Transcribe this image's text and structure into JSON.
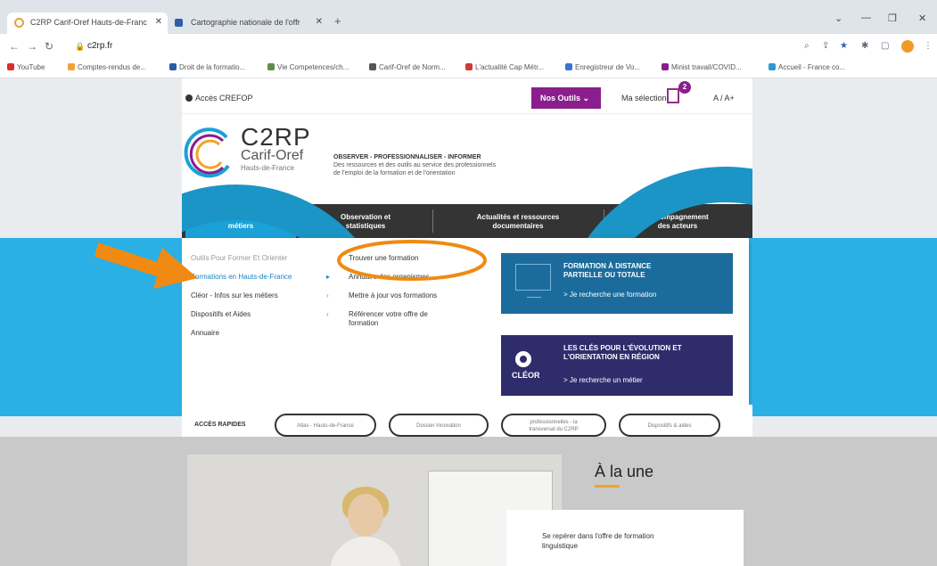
{
  "browser": {
    "tabs": [
      {
        "title": "C2RP Carif-Oref Hauts-de-Franc",
        "active": true
      },
      {
        "title": "Cartographie nationale de l'offr",
        "active": false
      }
    ],
    "url": "c2rp.fr",
    "bookmarks": [
      "YouTube",
      "Comptes-rendus de...",
      "Droit de la formatio...",
      "Vie Competences/ch...",
      "Carif-Oref de Norm...",
      "L'actualité Cap Métr...",
      "Enregistreur de Vo...",
      "Minist travail/COVID...",
      "Accueil - France co..."
    ],
    "colors": {
      "tabbar": "#dfe3ea",
      "profile": "#f09a26"
    }
  },
  "site": {
    "top": {
      "acces": "Accès CREFOP",
      "outils": "Nos Outils ⌄",
      "selection": "Ma sélection",
      "badge": "2",
      "textsize": "A / A+"
    },
    "logo": {
      "name": "C2RP",
      "sub": "Carif-Oref",
      "region": "Hauts-de-France"
    },
    "tagline": {
      "head": "OBSERVER - PROFESSIONNALISER - INFORMER",
      "line1": "Des ressources et des outils au service des professionnels",
      "line2": "de l'emploi de la formation et de l'orientation"
    },
    "nav": [
      {
        "line1": "Formations et",
        "line2": "métiers",
        "active": true
      },
      {
        "line1": "Observation et",
        "line2": "statistiques"
      },
      {
        "line1": "Actualités et ressources",
        "line2": "documentaires"
      },
      {
        "line1": "Accompagnement",
        "line2": "des acteurs"
      }
    ],
    "dropdown": {
      "left": [
        "Outils Pour Former Et Orienter",
        "Formations en Hauts-de-France",
        "Cléor - Infos sur les métiers",
        "Dispositifs et Aides",
        "Annuaire"
      ],
      "sub": [
        "Trouver une formation",
        "Annuaire des organismes",
        "Mettre à jour vos formations",
        "Référencer votre offre de",
        "formation"
      ]
    },
    "promos": [
      {
        "title1": "FORMATION À DISTANCE",
        "title2": "PARTIELLE OU TOTALE",
        "link": "> Je recherche une formation"
      },
      {
        "title1": "LES CLÉS POUR L'ÉVOLUTION ET",
        "title2": "L'ORIENTATION EN RÉGION",
        "link": "> Je recherche un métier",
        "brand": "CLÉOR"
      }
    ],
    "quick": {
      "label": "ACCÈS RAPIDES",
      "pills": [
        "Atlas - Hauts-de-France",
        "Dossier Innovation",
        "professionnelles - la",
        "Dispositifs & aides"
      ],
      "pill3_line2": "transversal du C2RP"
    },
    "une": {
      "title": "À la une",
      "card1": "Se repérer dans l'offre de formation",
      "card2": "linguistique"
    },
    "colors": {
      "primary": "#1aa1d7",
      "nav": "#343434",
      "outils": "#8a1e8c",
      "accent": "#f3a226"
    }
  },
  "annotations": {
    "arrow_color": "#f08a12",
    "highlight_color": "#f08a12"
  }
}
